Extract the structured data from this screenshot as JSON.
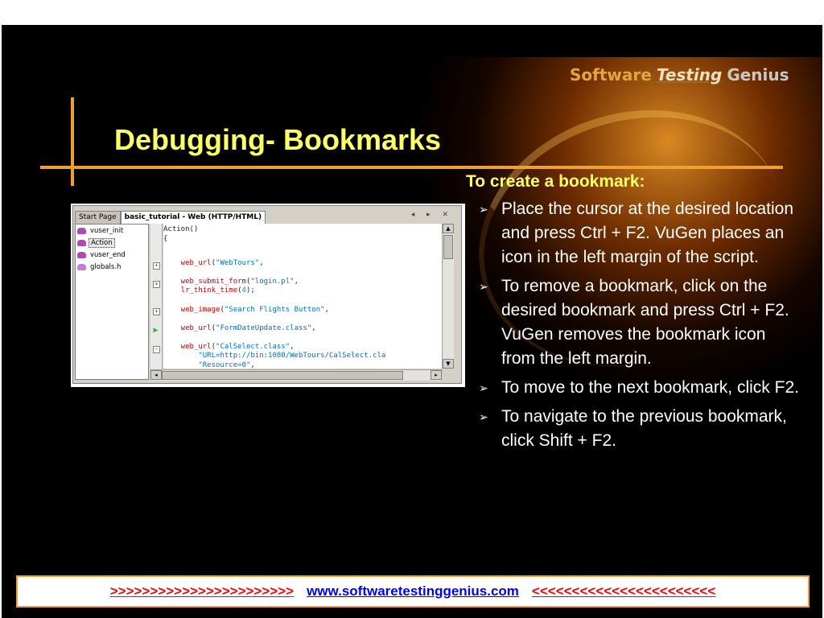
{
  "logo": {
    "word1": "Software",
    "word2": "Testing",
    "word3": "Genius"
  },
  "title": "Debugging- Bookmarks",
  "ide": {
    "tabs": [
      {
        "label": "Start Page",
        "active": false
      },
      {
        "label": "basic_tutorial - Web (HTTP/HTML)",
        "active": true
      }
    ],
    "tab_controls": "◂ ▸ ✕",
    "tree": [
      {
        "label": "vuser_init",
        "selected": false,
        "icon": "action-icon"
      },
      {
        "label": "Action",
        "selected": true,
        "icon": "action-icon"
      },
      {
        "label": "vuser_end",
        "selected": false,
        "icon": "action-icon"
      },
      {
        "label": "globals.h",
        "selected": false,
        "icon": "header-file-icon"
      }
    ],
    "code": [
      {
        "parts": [
          [
            "plain",
            "Action()"
          ]
        ]
      },
      {
        "parts": [
          [
            "plain",
            "{"
          ]
        ]
      },
      {
        "parts": [
          [
            "fn",
            "    web_url"
          ],
          [
            "plain",
            "("
          ],
          [
            "str",
            "\"WebTours\""
          ],
          [
            "plain",
            ","
          ]
        ]
      },
      {
        "parts": [
          [
            "fn",
            "    web_submit_form"
          ],
          [
            "plain",
            "("
          ],
          [
            "str",
            "\"login.pl\""
          ],
          [
            "plain",
            ","
          ]
        ]
      },
      {
        "parts": [
          [
            "fn",
            "    lr_think_time"
          ],
          [
            "plain",
            "("
          ],
          [
            "num",
            "4"
          ],
          [
            "plain",
            ");"
          ]
        ]
      },
      {
        "parts": [
          [
            "fn",
            "    web_image"
          ],
          [
            "plain",
            "("
          ],
          [
            "str",
            "\"Search Flights Button\""
          ],
          [
            "plain",
            ","
          ]
        ]
      },
      {
        "parts": [
          [
            "fn",
            "    web_url"
          ],
          [
            "plain",
            "("
          ],
          [
            "str",
            "\"FormDateUpdate.class\""
          ],
          [
            "plain",
            ","
          ]
        ]
      },
      {
        "parts": [
          [
            "fn",
            "    web_url"
          ],
          [
            "plain",
            "("
          ],
          [
            "str",
            "\"CalSelect.class\""
          ],
          [
            "plain",
            ","
          ]
        ]
      },
      {
        "parts": [
          [
            "str",
            "        \"URL=http://bin:1080/WebTours/CalSelect.cla"
          ]
        ]
      },
      {
        "parts": [
          [
            "str",
            "        \"Resource=0\""
          ],
          [
            "plain",
            ","
          ]
        ]
      }
    ],
    "gutter_marks": [
      "+",
      "+",
      "+",
      "bookmark",
      "−"
    ]
  },
  "content": {
    "heading": "To create a bookmark:",
    "bullet_icon": "arrow-bullet-icon",
    "bullets": [
      "Place the cursor at the desired location and press Ctrl + F2. VuGen places an icon in the left margin of the script.",
      "To remove a bookmark, click on the desired bookmark and press Ctrl + F2. VuGen removes the bookmark icon from the left margin.",
      "To move to the next bookmark, click F2.",
      "To navigate to the previous bookmark, click Shift + F2."
    ]
  },
  "footer": {
    "left_arrows": ">>>>>>>>>>>>>>>>>>>>>>>",
    "url": "www.softwaretestinggenius.com",
    "right_arrows": "<<<<<<<<<<<<<<<<<<<<<<<"
  },
  "colors": {
    "title": "#ffff66",
    "accent_bar": "#f0a030",
    "background": "#000000",
    "footer_arrows": "#ff0000",
    "footer_url": "#0000ff"
  }
}
